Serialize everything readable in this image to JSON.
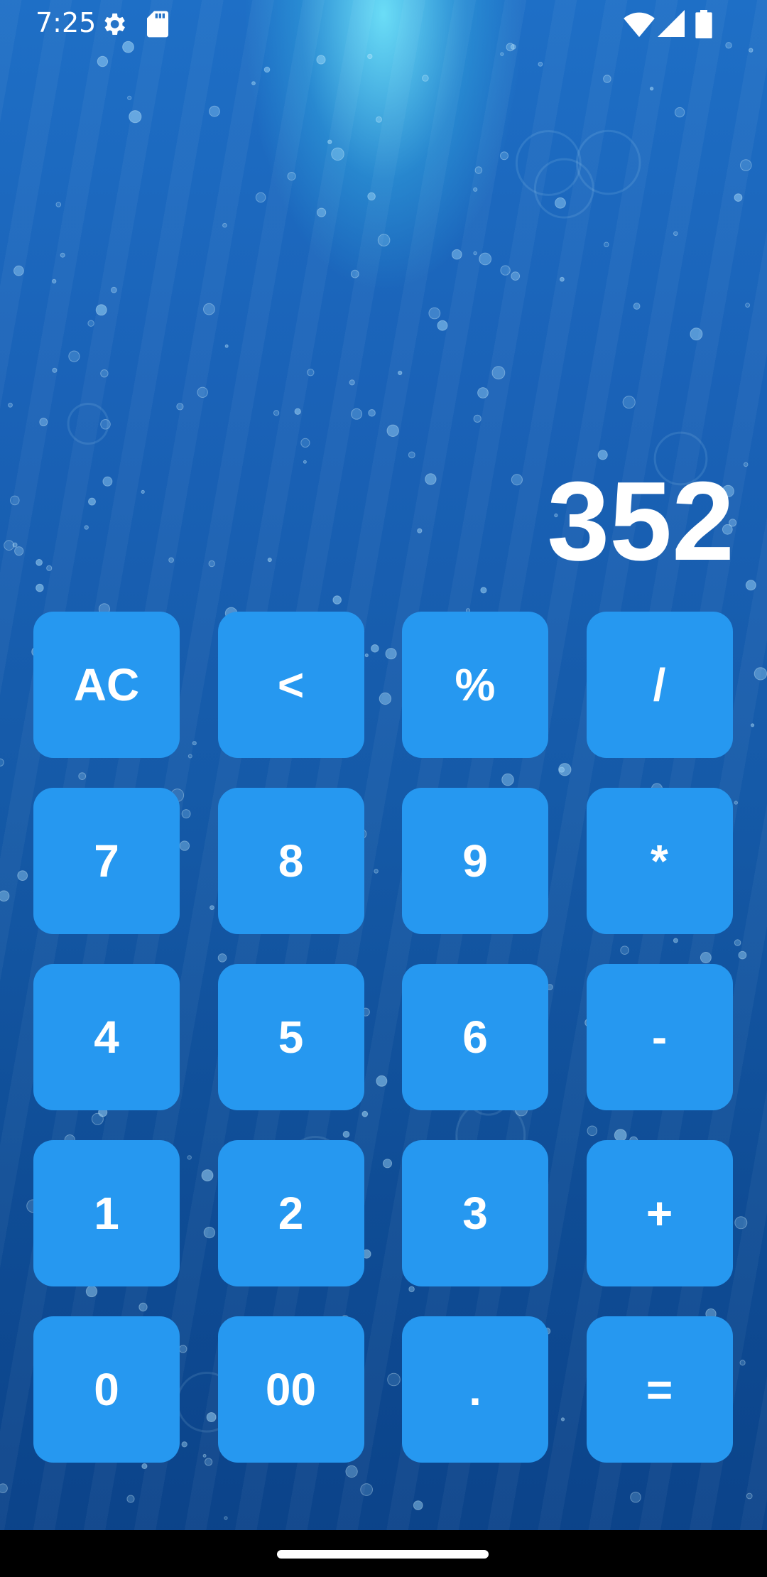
{
  "status_bar": {
    "time": "7:25",
    "icons": [
      "gear-icon",
      "sd-card-icon",
      "wifi-icon",
      "signal-icon",
      "battery-icon"
    ]
  },
  "display": {
    "value": "352"
  },
  "keypad": {
    "keys": [
      {
        "label": "AC",
        "name": "all-clear-button"
      },
      {
        "label": "<",
        "name": "backspace-button"
      },
      {
        "label": "%",
        "name": "percent-button"
      },
      {
        "label": "/",
        "name": "divide-button"
      },
      {
        "label": "7",
        "name": "digit-7-button"
      },
      {
        "label": "8",
        "name": "digit-8-button"
      },
      {
        "label": "9",
        "name": "digit-9-button"
      },
      {
        "label": "*",
        "name": "multiply-button"
      },
      {
        "label": "4",
        "name": "digit-4-button"
      },
      {
        "label": "5",
        "name": "digit-5-button"
      },
      {
        "label": "6",
        "name": "digit-6-button"
      },
      {
        "label": "-",
        "name": "subtract-button"
      },
      {
        "label": "1",
        "name": "digit-1-button"
      },
      {
        "label": "2",
        "name": "digit-2-button"
      },
      {
        "label": "3",
        "name": "digit-3-button"
      },
      {
        "label": "+",
        "name": "add-button"
      },
      {
        "label": "0",
        "name": "digit-0-button"
      },
      {
        "label": "00",
        "name": "double-zero-button"
      },
      {
        "label": ".",
        "name": "decimal-button"
      },
      {
        "label": "=",
        "name": "equals-button"
      }
    ]
  },
  "colors": {
    "key_background": "#2698f0",
    "text": "#ffffff",
    "background_top": "#1e6fc6",
    "background_bottom": "#0b4288"
  }
}
